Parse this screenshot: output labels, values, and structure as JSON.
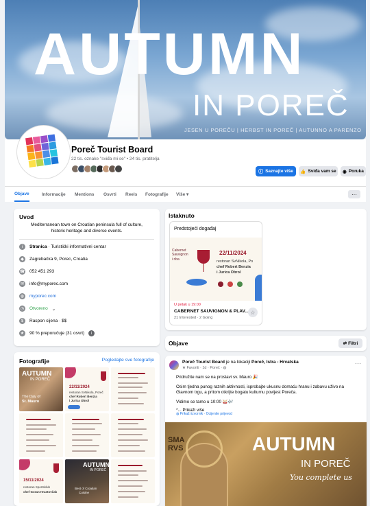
{
  "cover": {
    "title": "AUTUMN",
    "subtitle": "IN POREČ",
    "tagline": "JESEN U POREČU | HERBST IN POREČ | AUTUNNO A PARENZO"
  },
  "page": {
    "name": "Poreč Tourist Board",
    "stats": "22 tis. oznake \"sviđa mi se\" • 24 tis. pratitelja",
    "actions": {
      "learn_more": "Saznajte više",
      "liked": "Sviđa vam se",
      "message": "Poruka"
    }
  },
  "tabs": [
    "Objave",
    "Informacije",
    "Mentions",
    "Osvrti",
    "Reels",
    "Fotografije",
    "Više ▾"
  ],
  "intro": {
    "title": "Uvod",
    "bio": "Mediterranean town on Croatian peninsula full of culture, historic heritage and diverse events.",
    "category_prefix": "Stranica",
    "category": " · Turistički informativni centar",
    "address": "Zagrebačka 9, Porec, Croatia",
    "phone": "052 451 293",
    "email": "info@myporec.com",
    "website": "myporec.com",
    "hours": "Otvoreno",
    "hours_suffix": " ⌄",
    "price": "Raspon cijena · $$",
    "rating": "90 % preporučuje (31 osvrt)"
  },
  "featured": {
    "title": "Istaknuto",
    "label": "Predstojeći događaj",
    "poster": {
      "date": "22/11/2024",
      "lines": [
        "restoran SvNikola, Po",
        "chef Robert Benzia",
        "i Jurica Obrol"
      ],
      "left_lines": [
        "Cabernet",
        "Sauvignon",
        "i riba"
      ]
    },
    "event_date": "U petak u 19:00",
    "event_name": "CABERNET SAUVIGNON & PLAV...",
    "event_stats": "21 Interested · 2 Going"
  },
  "photos": {
    "title": "Fotografije",
    "link": "Pogledajte sve fotografije",
    "cells": [
      {
        "kind": "autumn",
        "big": "AUTUMN",
        "small": "IN POREČ",
        "cap1": "The Day of",
        "cap2": "St. Mauro"
      },
      {
        "kind": "poster",
        "date": "22/11/2024",
        "l1": "restoran SvNikola, Poreč",
        "l2": "chef Robert Benzia",
        "l3": "i Jurica Obrol"
      },
      {
        "kind": "menu"
      },
      {
        "kind": "menu"
      },
      {
        "kind": "menu"
      },
      {
        "kind": "menu"
      },
      {
        "kind": "poster2",
        "date": "15/11/2024",
        "l1": "restoran Sportsklub",
        "l2": "chef Goran Hrastovčak"
      },
      {
        "kind": "dark",
        "big": "AUTUMN",
        "small": "IN POREČ",
        "cap": "Best of Croatian",
        "cap2": "Cuisine"
      },
      {
        "kind": "menu"
      }
    ]
  },
  "posts": {
    "title": "Objave",
    "filter": "Filtri",
    "author": "Poreč Tourist Board",
    "location_pre": " je na lokaciji ",
    "location": "Poreč, Istra - Hrvatska",
    "meta": "★ Favoriti · 1d · Poreč · ◍",
    "line1": "Pridružite nam se na proslavi sv. Mauro 🎉",
    "line2": "Osim tjedna punog raznih aktivnosti, isprobajte ukusnu domaću hranu i zabavu uživo na Glavnom trgu, a pritom otkrijte bogatu kulturnu povijest Poreča.",
    "line3": "Vidimo se tamo u 10:00 🥁🎶",
    "see_more": "*... Prikaži više",
    "translate": "Prikaži izvornik",
    "rate_translation": "Ocijenite prijevod",
    "image": {
      "big": "AUTUMN",
      "small": "IN POREČ",
      "script": "You complete us",
      "mosaic": "SMA RVS"
    }
  },
  "colors": {
    "accent": "#1b74e4",
    "cover_sky": "#7aa6d2",
    "wine": "#b31f3b"
  }
}
